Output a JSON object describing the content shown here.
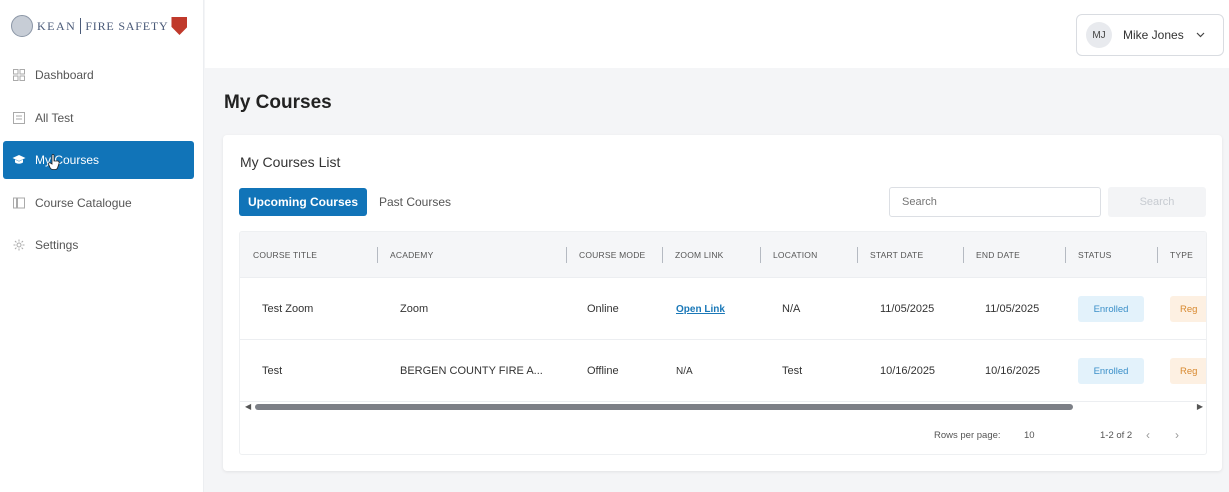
{
  "logo": {
    "part1": "KEAN",
    "part2": "FIRE SAFETY"
  },
  "sidebar": {
    "items": [
      {
        "label": "Dashboard",
        "icon": "grid-icon"
      },
      {
        "label": "All Test",
        "icon": "document-icon"
      },
      {
        "label": "My Courses",
        "icon": "graduation-cap-icon",
        "active": true
      },
      {
        "label": "Course Catalogue",
        "icon": "catalogue-icon"
      },
      {
        "label": "Settings",
        "icon": "gear-icon"
      }
    ]
  },
  "header": {
    "user": {
      "initials": "MJ",
      "name": "Mike Jones"
    }
  },
  "main": {
    "title": "My Courses",
    "card_title": "My Courses List",
    "tabs": [
      {
        "label": "Upcoming Courses",
        "active": true
      },
      {
        "label": "Past Courses",
        "active": false
      }
    ],
    "search": {
      "placeholder": "Search",
      "button_label": "Search"
    },
    "table": {
      "columns": [
        "COURSE TITLE",
        "ACADEMY",
        "COURSE MODE",
        "ZOOM LINK",
        "LOCATION",
        "START DATE",
        "END DATE",
        "STATUS",
        "TYPE"
      ],
      "rows": [
        {
          "title": "Test Zoom",
          "academy": "Zoom",
          "mode": "Online",
          "zoom": "Open Link",
          "location": "N/A",
          "start": "11/05/2025",
          "end": "11/05/2025",
          "status": "Enrolled",
          "type": "Reg"
        },
        {
          "title": "Test",
          "academy": "BERGEN COUNTY FIRE A...",
          "mode": "Offline",
          "zoom": "N/A",
          "location": "Test",
          "start": "10/16/2025",
          "end": "10/16/2025",
          "status": "Enrolled",
          "type": "Reg"
        }
      ]
    },
    "pagination": {
      "rows_per_page_label": "Rows per page:",
      "rows_per_page": "10",
      "range": "1-2 of 2"
    }
  },
  "colors": {
    "accent": "#1174b8",
    "status_bg": "#e3f2fb",
    "type_bg": "#fdf0e2"
  }
}
